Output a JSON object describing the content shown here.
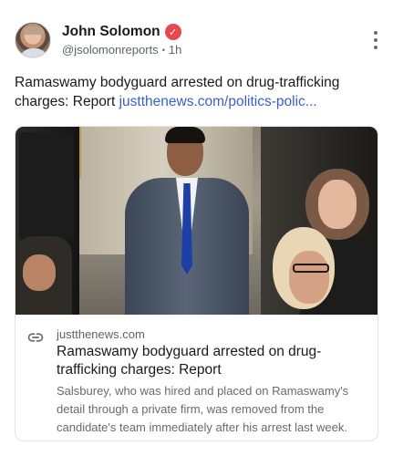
{
  "author": {
    "name": "John Solomon",
    "handle": "@jsolomonreports",
    "time": "1h",
    "verified_badge": "checkmark-icon"
  },
  "post": {
    "text": "Ramaswamy bodyguard arrested on drug-trafficking charges: Report ",
    "link": "justthenews.com/politics-polic..."
  },
  "link_card": {
    "domain": "justthenews.com",
    "title": "Ramaswamy bodyguard arrested on drug-trafficking charges: Report",
    "description": "Salsburey, who was hired and placed on Ramaswamy's detail through a private firm, was removed from the candidate's team immediately after his arrest last week.",
    "icon": "link-icon"
  },
  "colors": {
    "badge": "#e5484d",
    "link": "#3a5fcd",
    "secondary_text": "#5f6368"
  }
}
